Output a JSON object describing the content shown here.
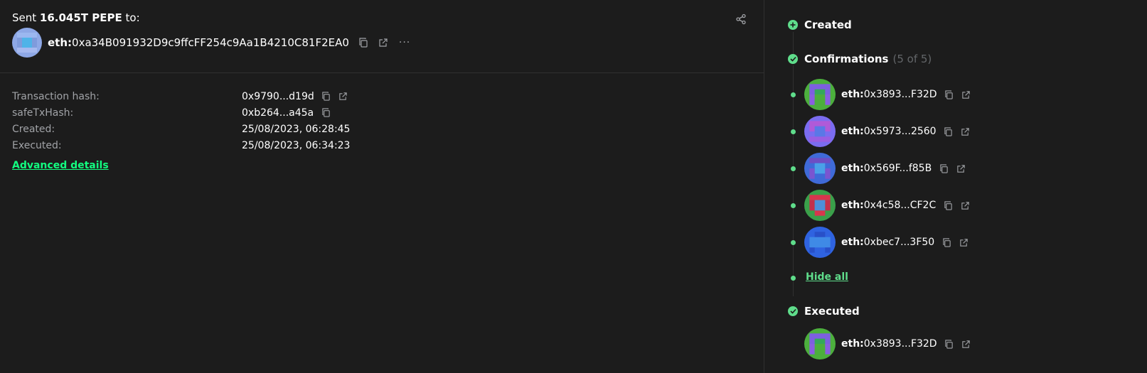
{
  "transaction": {
    "summary_prefix": "Sent",
    "amount": "16.045T PEPE",
    "summary_suffix": "to:",
    "recipient_prefix": "eth:",
    "recipient_address": "0xa34B091932D9c9ffcFF254c9Aa1B4210C81F2EA0",
    "more_label": "···"
  },
  "details": {
    "rows": [
      {
        "label": "Transaction hash:",
        "value": "0x9790...d19d"
      },
      {
        "label": "safeTxHash:",
        "value": "0xb264...a45a"
      },
      {
        "label": "Created:",
        "value": "25/08/2023, 06:28:45"
      },
      {
        "label": "Executed:",
        "value": "25/08/2023, 06:34:23"
      }
    ],
    "advanced_label": "Advanced details"
  },
  "timeline": {
    "created_label": "Created",
    "confirmations_label": "Confirmations",
    "confirmations_count": "(5 of 5)",
    "confirmations": [
      {
        "prefix": "eth:",
        "address": "0x3893...F32D"
      },
      {
        "prefix": "eth:",
        "address": "0x5973...2560"
      },
      {
        "prefix": "eth:",
        "address": "0x569F...f85B"
      },
      {
        "prefix": "eth:",
        "address": "0x4c58...CF2C"
      },
      {
        "prefix": "eth:",
        "address": "0xbec7...3F50"
      }
    ],
    "hide_all_label": "Hide all",
    "executed_label": "Executed",
    "executor": {
      "prefix": "eth:",
      "address": "0x3893...F32D"
    }
  },
  "colors": {
    "accent_green": "#12ff80",
    "timeline_green": "#5fdd8b",
    "background": "#1c1c1c",
    "muted_text": "#a1a3a7"
  },
  "icons": [
    "share-icon",
    "copy-icon",
    "external-link-icon",
    "more-icon",
    "plus-circle-icon",
    "check-circle-icon"
  ]
}
